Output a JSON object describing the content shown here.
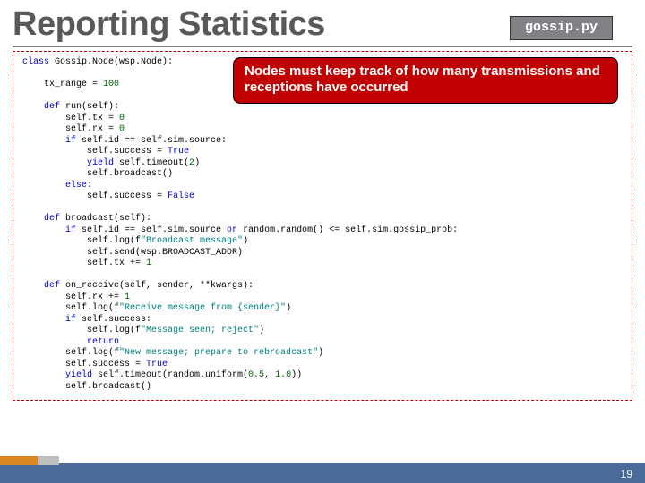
{
  "title": "Reporting Statistics",
  "filename": "gossip.py",
  "callout": "Nodes must keep track of how many transmissions and receptions have occurred",
  "code": {
    "l01a": "class",
    "l01b": " Gossip.Node(wsp.Node):",
    "l02": "",
    "l03a": "    tx_range = ",
    "l03n": "100",
    "l04": "",
    "l05a": "    def",
    "l05b": " run(self):",
    "l06a": "        self.tx = ",
    "l06n": "0",
    "l07a": "        self.rx = ",
    "l07n": "0",
    "l08a": "        if",
    "l08b": " self.id == self.sim.source:",
    "l09a": "            self.success = ",
    "l09b": "True",
    "l10a": "            yield",
    "l10b": " self.timeout(",
    "l10n": "2",
    "l10c": ")",
    "l11": "            self.broadcast()",
    "l12a": "        else",
    "l12b": ":",
    "l13a": "            self.success = ",
    "l13b": "False",
    "l14": "",
    "l15a": "    def",
    "l15b": " broadcast(self):",
    "l16a": "        if",
    "l16b": " self.id == self.sim.source ",
    "l16c": "or",
    "l16d": " random.random() <= self.sim.gossip_prob:",
    "l17a": "            self.log(f",
    "l17s": "\"Broadcast message\"",
    "l17b": ")",
    "l18": "            self.send(wsp.BROADCAST_ADDR)",
    "l19a": "            self.tx += ",
    "l19n": "1",
    "l20": "",
    "l21a": "    def",
    "l21b": " on_receive(self, sender, **kwargs):",
    "l22a": "        self.rx += ",
    "l22n": "1",
    "l23a": "        self.log(f",
    "l23s": "\"Receive message from {sender}\"",
    "l23b": ")",
    "l24a": "        if",
    "l24b": " self.success:",
    "l25a": "            self.log(f",
    "l25s": "\"Message seen; reject\"",
    "l25b": ")",
    "l26a": "            return",
    "l27a": "        self.log(f",
    "l27s": "\"New message; prepare to rebroadcast\"",
    "l27b": ")",
    "l28a": "        self.success = ",
    "l28b": "True",
    "l29a": "        yield",
    "l29b": " self.timeout(random.uniform(",
    "l29n1": "0.5",
    "l29c": ", ",
    "l29n2": "1.0",
    "l29d": "))",
    "l30": "        self.broadcast()"
  },
  "page_number": "19"
}
